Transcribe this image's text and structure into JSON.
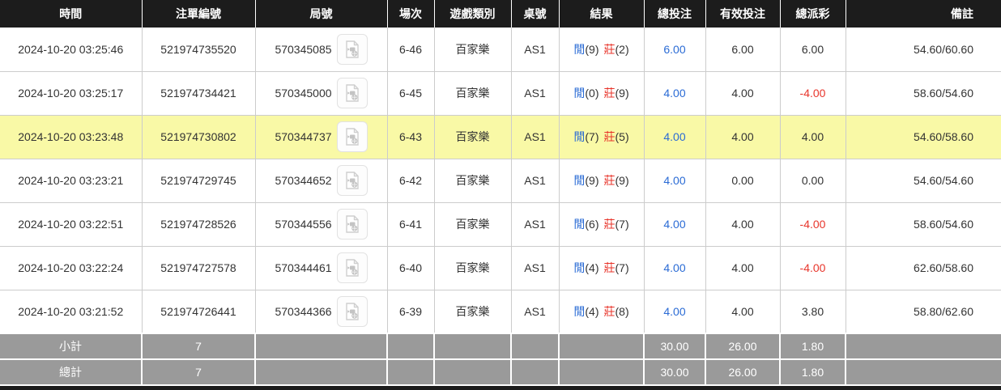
{
  "colors": {
    "header_bg": "#1c1c1c",
    "header_text": "#ffffff",
    "row_border": "#cccccc",
    "highlight_row_bg": "#f9f9a6",
    "footer_bg": "#9a9a9a",
    "footer_text": "#ffffff",
    "body_text": "#333333",
    "accent_blue": "#2a6bd5",
    "accent_red": "#e8352b"
  },
  "table": {
    "columns": [
      {
        "key": "time",
        "label": "時間"
      },
      {
        "key": "bet_id",
        "label": "注單編號"
      },
      {
        "key": "round",
        "label": "局號"
      },
      {
        "key": "session",
        "label": "場次"
      },
      {
        "key": "game_type",
        "label": "遊戲類別"
      },
      {
        "key": "table_no",
        "label": "桌號"
      },
      {
        "key": "result",
        "label": "結果"
      },
      {
        "key": "total_bet",
        "label": "總投注"
      },
      {
        "key": "valid_bet",
        "label": "有效投注"
      },
      {
        "key": "total_payout",
        "label": "總派彩"
      },
      {
        "key": "remark",
        "label": "備註"
      }
    ],
    "video_icon": "video-file-icon",
    "rows": [
      {
        "time": "2024-10-20 03:25:46",
        "bet_id": "521974735520",
        "round": "570345085",
        "session": "6-46",
        "game_type": "百家樂",
        "table_no": "AS1",
        "player_label": "閒",
        "player_score": "(9)",
        "banker_label": "莊",
        "banker_score": "(2)",
        "total_bet": "6.00",
        "valid_bet": "6.00",
        "total_payout": "6.00",
        "remark": "54.60/60.60",
        "highlight": false
      },
      {
        "time": "2024-10-20 03:25:17",
        "bet_id": "521974734421",
        "round": "570345000",
        "session": "6-45",
        "game_type": "百家樂",
        "table_no": "AS1",
        "player_label": "閒",
        "player_score": "(0)",
        "banker_label": "莊",
        "banker_score": "(9)",
        "total_bet": "4.00",
        "valid_bet": "4.00",
        "total_payout": "-4.00",
        "remark": "58.60/54.60",
        "highlight": false
      },
      {
        "time": "2024-10-20 03:23:48",
        "bet_id": "521974730802",
        "round": "570344737",
        "session": "6-43",
        "game_type": "百家樂",
        "table_no": "AS1",
        "player_label": "閒",
        "player_score": "(7)",
        "banker_label": "莊",
        "banker_score": "(5)",
        "total_bet": "4.00",
        "valid_bet": "4.00",
        "total_payout": "4.00",
        "remark": "54.60/58.60",
        "highlight": true
      },
      {
        "time": "2024-10-20 03:23:21",
        "bet_id": "521974729745",
        "round": "570344652",
        "session": "6-42",
        "game_type": "百家樂",
        "table_no": "AS1",
        "player_label": "閒",
        "player_score": "(9)",
        "banker_label": "莊",
        "banker_score": "(9)",
        "total_bet": "4.00",
        "valid_bet": "0.00",
        "total_payout": "0.00",
        "remark": "54.60/54.60",
        "highlight": false
      },
      {
        "time": "2024-10-20 03:22:51",
        "bet_id": "521974728526",
        "round": "570344556",
        "session": "6-41",
        "game_type": "百家樂",
        "table_no": "AS1",
        "player_label": "閒",
        "player_score": "(6)",
        "banker_label": "莊",
        "banker_score": "(7)",
        "total_bet": "4.00",
        "valid_bet": "4.00",
        "total_payout": "-4.00",
        "remark": "58.60/54.60",
        "highlight": false
      },
      {
        "time": "2024-10-20 03:22:24",
        "bet_id": "521974727578",
        "round": "570344461",
        "session": "6-40",
        "game_type": "百家樂",
        "table_no": "AS1",
        "player_label": "閒",
        "player_score": "(4)",
        "banker_label": "莊",
        "banker_score": "(7)",
        "total_bet": "4.00",
        "valid_bet": "4.00",
        "total_payout": "-4.00",
        "remark": "62.60/58.60",
        "highlight": false
      },
      {
        "time": "2024-10-20 03:21:52",
        "bet_id": "521974726441",
        "round": "570344366",
        "session": "6-39",
        "game_type": "百家樂",
        "table_no": "AS1",
        "player_label": "閒",
        "player_score": "(4)",
        "banker_label": "莊",
        "banker_score": "(8)",
        "total_bet": "4.00",
        "valid_bet": "4.00",
        "total_payout": "3.80",
        "remark": "58.80/62.60",
        "highlight": false
      }
    ],
    "footer": [
      {
        "label": "小計",
        "count": "7",
        "total_bet": "30.00",
        "valid_bet": "26.00",
        "total_payout": "1.80"
      },
      {
        "label": "總計",
        "count": "7",
        "total_bet": "30.00",
        "valid_bet": "26.00",
        "total_payout": "1.80"
      }
    ]
  }
}
